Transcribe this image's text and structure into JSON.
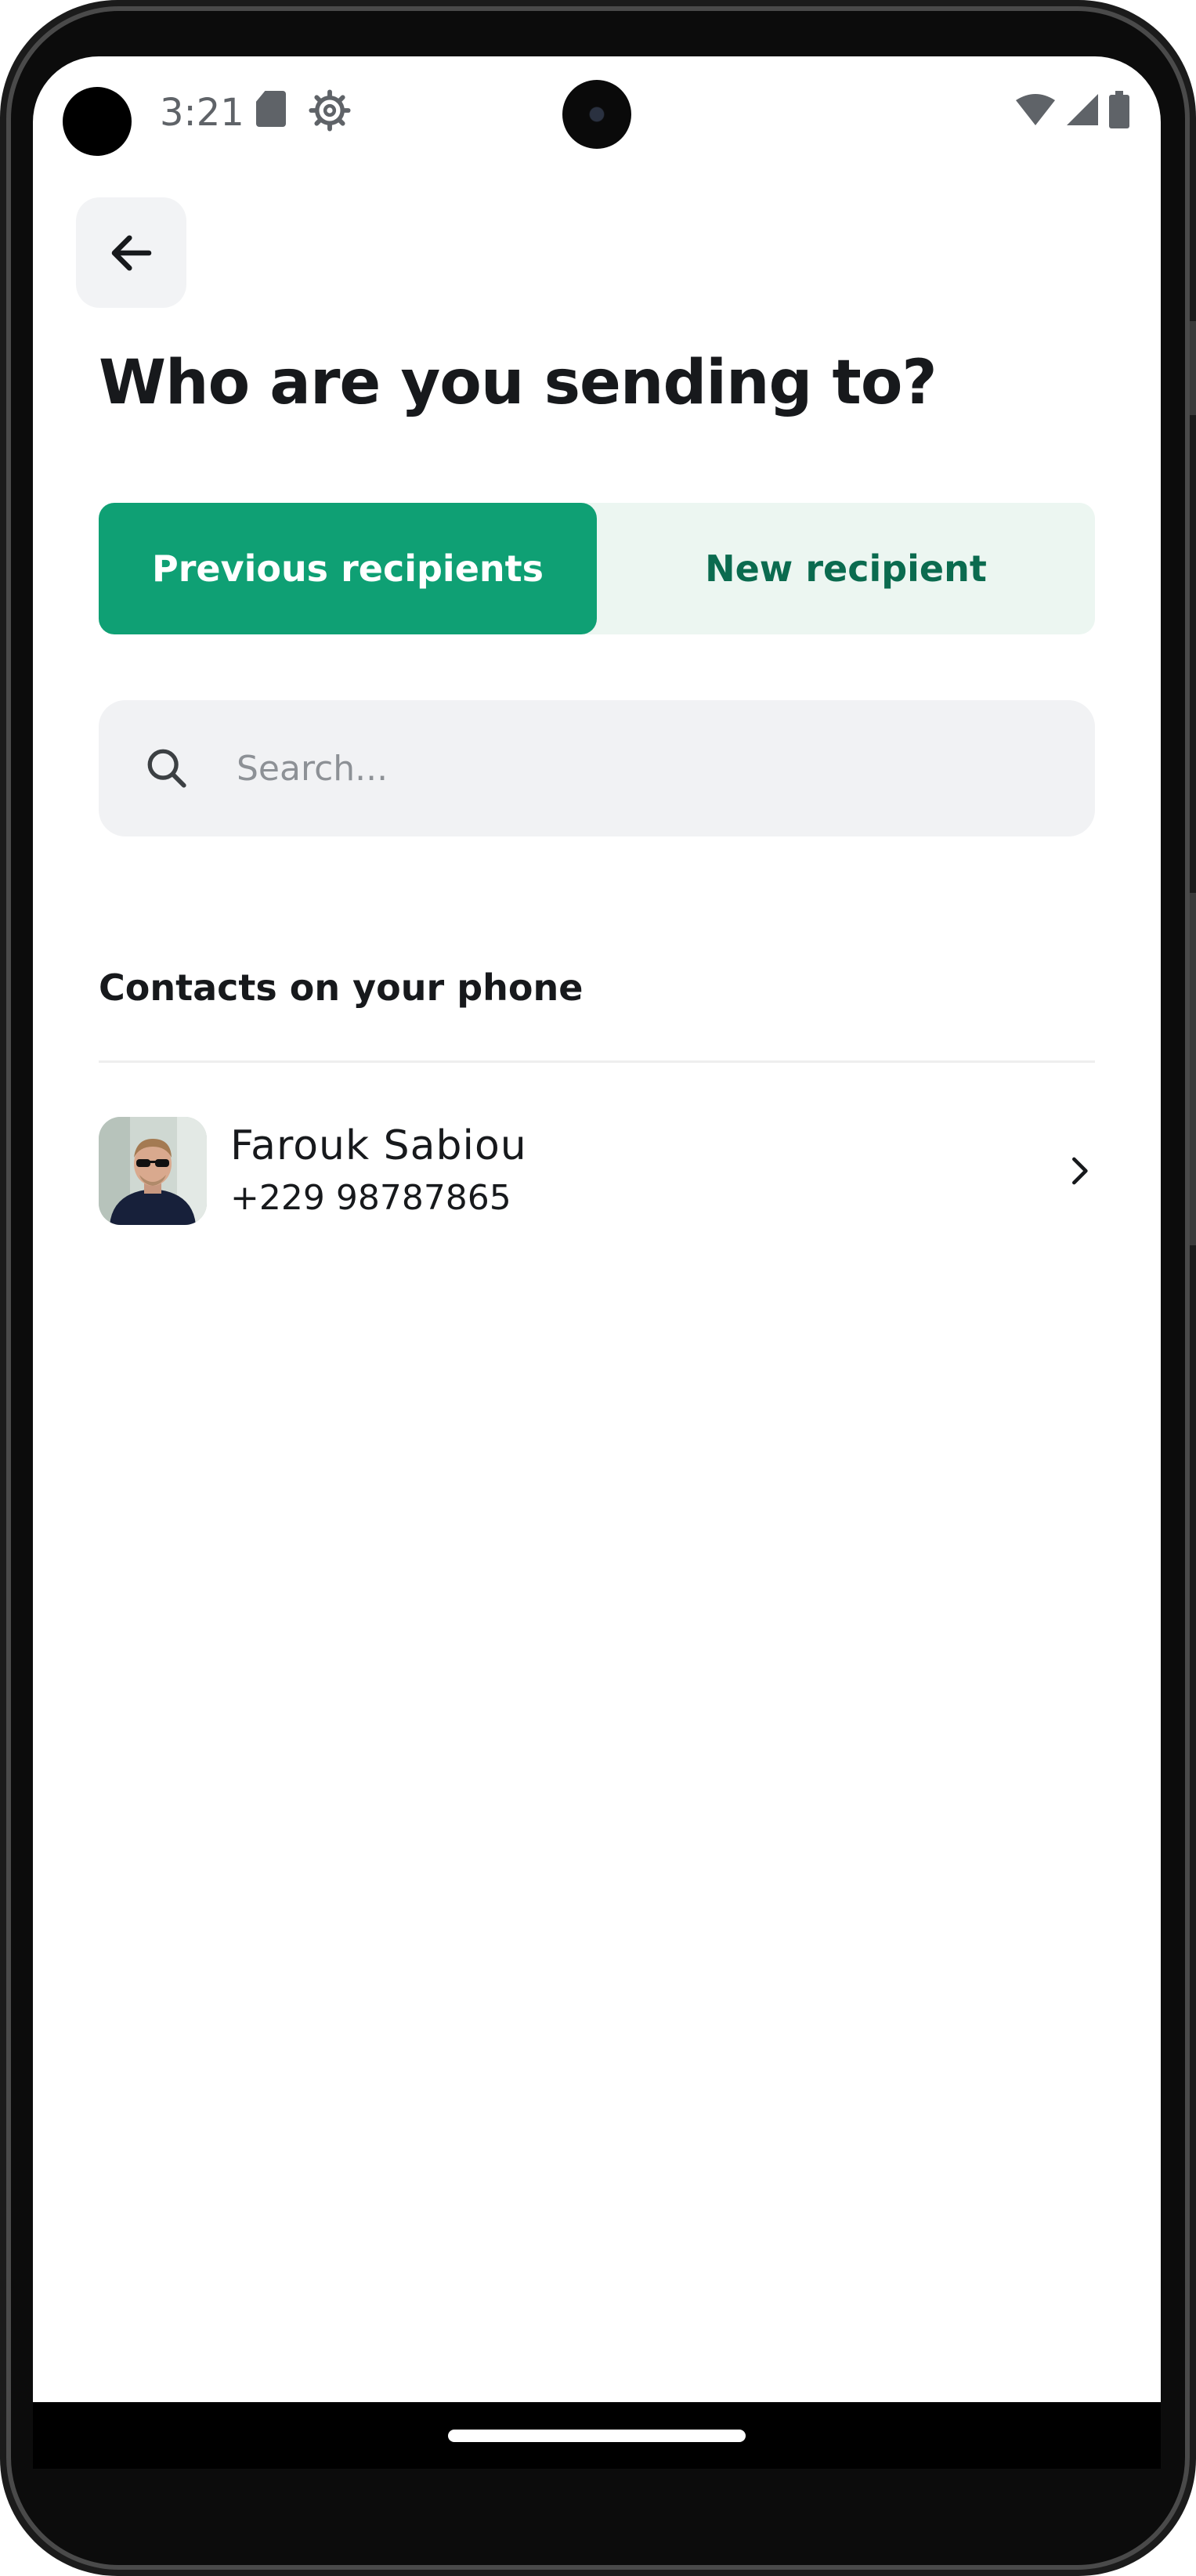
{
  "status_bar": {
    "time": "3:21",
    "icons": [
      "sd-card-icon",
      "settings-gear-icon",
      "wifi-icon",
      "cellular-signal-icon",
      "battery-icon"
    ]
  },
  "header": {
    "back_icon": "arrow-left-icon",
    "title": "Who are you sending to?"
  },
  "tabs": [
    {
      "label": "Previous recipients",
      "active": true
    },
    {
      "label": "New recipient",
      "active": false
    }
  ],
  "search": {
    "placeholder": "Search...",
    "value": "",
    "icon": "search-icon"
  },
  "contacts_section": {
    "title": "Contacts on your phone",
    "items": [
      {
        "name": "Farouk Sabiou",
        "phone": "+229 98787865",
        "avatar": "user-photo"
      }
    ]
  },
  "colors": {
    "accent": "#0fa074",
    "accent_text": "#0b6b4f",
    "accent_light": "#ecf6f1",
    "field_bg": "#f1f2f4",
    "text": "#17191c"
  }
}
